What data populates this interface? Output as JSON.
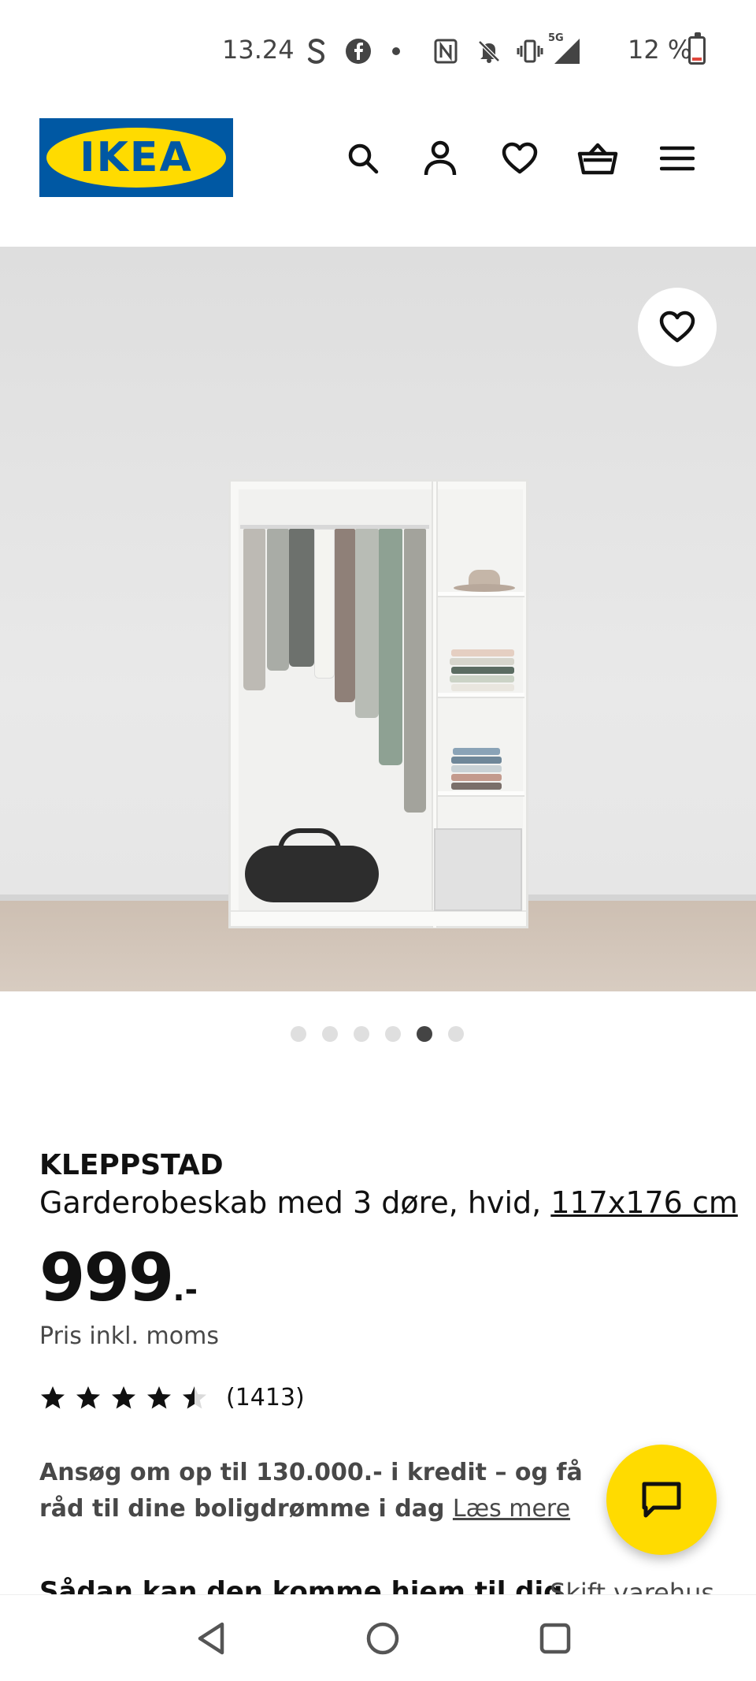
{
  "status_bar": {
    "time": "13.24",
    "battery": "12 %",
    "icons": [
      "s-app-icon",
      "facebook-icon",
      "dot-icon",
      "nfc-icon",
      "mute-icon",
      "vibrate-icon",
      "signal-5g-icon",
      "battery-icon"
    ],
    "network_label": "5G"
  },
  "header": {
    "logo_text": "IKEA",
    "icons": [
      "search-icon",
      "account-icon",
      "heart-icon",
      "basket-icon",
      "menu-icon"
    ]
  },
  "carousel": {
    "total": 6,
    "active_index": 4
  },
  "product": {
    "brand": "KLEPPSTAD",
    "description": "Garderobeskab med 3 døre, hvid, ",
    "dimensions": "117x176 cm",
    "price": "999",
    "price_suffix": ".-",
    "price_note": "Pris inkl. moms",
    "rating": 4.5,
    "rating_max": 5,
    "review_count": "(1413)"
  },
  "promo": {
    "text": "Ansøg om op til 130.000.- i kredit – og få råd til dine boligdrømme i dag",
    "link": "Læs mere"
  },
  "delivery": {
    "title": "Sådan kan den komme hjem til dig",
    "link": "Skift varehus"
  },
  "colors": {
    "ikea_blue": "#0058a3",
    "ikea_yellow": "#ffdb00",
    "text_dark": "#111111",
    "text_muted": "#484848"
  }
}
